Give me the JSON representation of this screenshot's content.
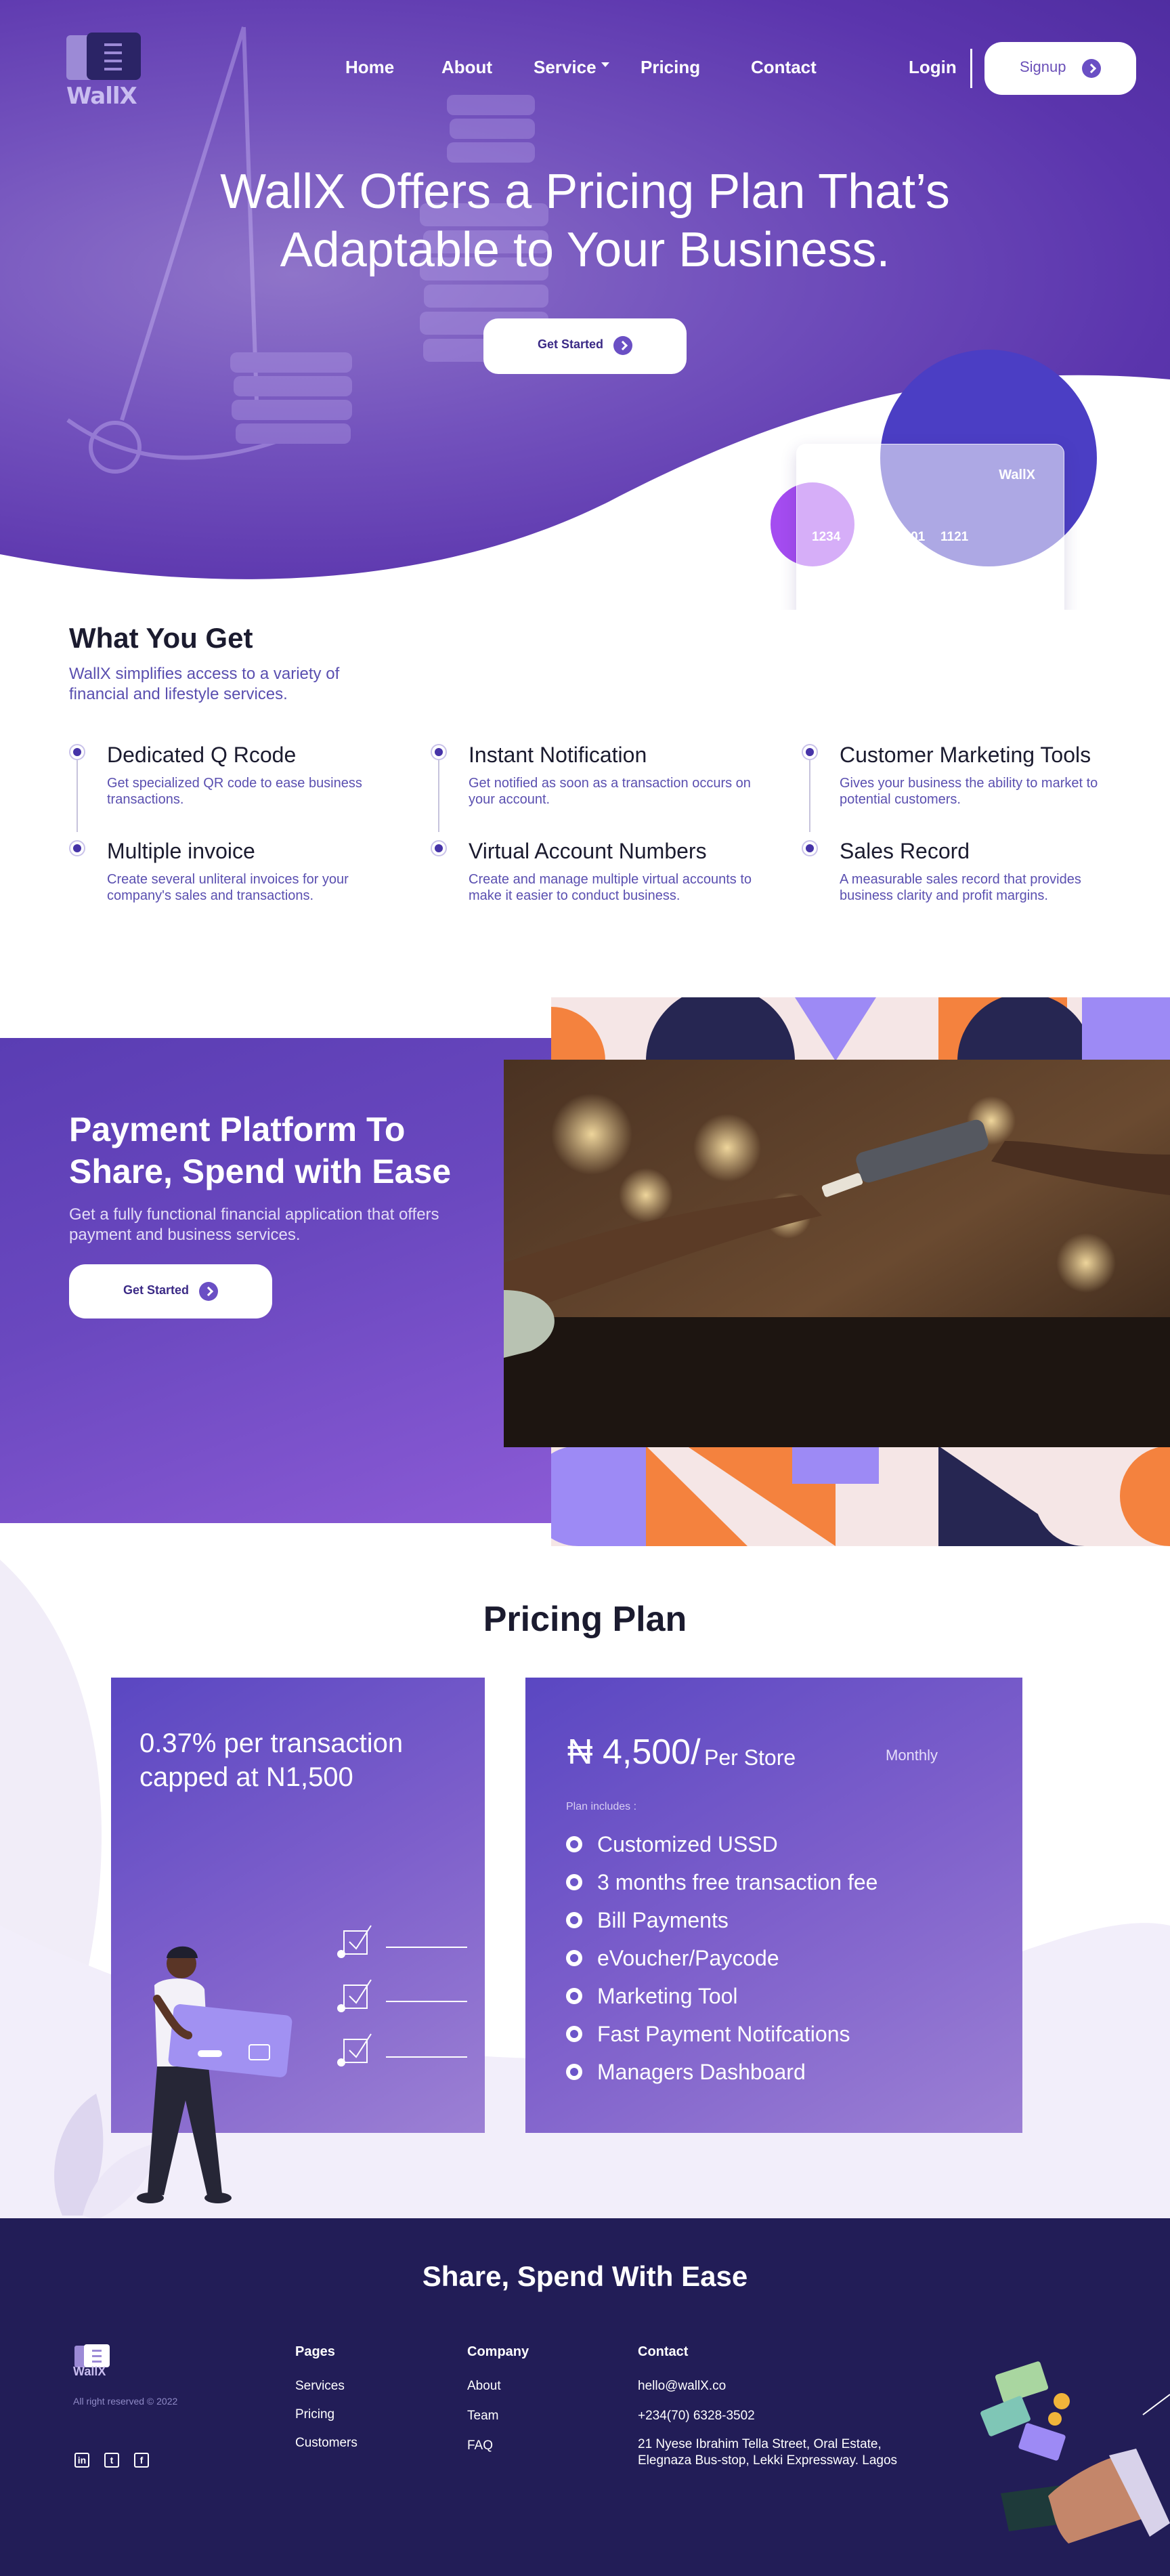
{
  "brand": {
    "name": "WallX"
  },
  "nav": {
    "home": "Home",
    "about": "About",
    "service": "Service",
    "pricing": "Pricing",
    "contact": "Contact",
    "login": "Login",
    "signup": "Signup"
  },
  "hero": {
    "title_line1": "WallX Offers a Pricing Plan That’s",
    "title_line2": "Adaptable to Your Business.",
    "cta": "Get Started",
    "card": {
      "brand": "WallX",
      "numbers": [
        "1234",
        "1101",
        "1121"
      ]
    }
  },
  "what_you_get": {
    "title": "What You Get",
    "subtitle": "WallX simplifies access to a variety of financial and lifestyle services.",
    "features": [
      {
        "title": "Dedicated Q Rcode",
        "desc": "Get specialized QR code to ease business transactions."
      },
      {
        "title": "Multiple invoice",
        "desc": "Create several unliteral invoices for your company's sales and transactions."
      },
      {
        "title": "Instant Notification",
        "desc": "Get notified as soon as a transaction occurs on your account."
      },
      {
        "title": "Virtual Account Numbers",
        "desc": "Create and manage multiple virtual accounts to make it easier to conduct business."
      },
      {
        "title": "Customer Marketing Tools",
        "desc": "Gives your business the ability to market to potential customers."
      },
      {
        "title": "Sales Record",
        "desc": "A measurable sales record that provides business clarity and  profit margins."
      }
    ]
  },
  "payment": {
    "title": "Payment Platform To Share, Spend with Ease",
    "subtitle": "Get a fully functional financial application that offers payment and business services.",
    "cta": "Get Started"
  },
  "pricing": {
    "title": "Pricing Plan",
    "plan1": {
      "headline": "0.37% per transaction capped at N1,500"
    },
    "plan2": {
      "price": "₦ 4,500/",
      "per": "Per Store",
      "period": "Monthly",
      "includes_label": "Plan includes :",
      "items": [
        "Customized USSD",
        "3 months free transaction fee",
        "Bill Payments",
        "eVoucher/Paycode",
        "Marketing Tool",
        "Fast Payment Notifcations",
        "Managers Dashboard"
      ]
    }
  },
  "footer": {
    "title": "Share, Spend With Ease",
    "copyright": "All right reserved © 2022",
    "pages": {
      "heading": "Pages",
      "links": [
        "Services",
        "Pricing",
        "Customers"
      ]
    },
    "company": {
      "heading": "Company",
      "links": [
        "About",
        "Team",
        "FAQ"
      ]
    },
    "contact": {
      "heading": "Contact",
      "email": "hello@wallX.co",
      "phone": "+234(70) 6328-3502",
      "address_line1": "21 Nyese Ibrahim Tella Street, Oral Estate,",
      "address_line2": "Elegnaza Bus-stop, Lekki Expressway. Lagos"
    },
    "social_icons": [
      "linkedin-icon",
      "twitter-icon",
      "facebook-icon"
    ]
  },
  "colors": {
    "primary": "#5b35ad",
    "accent": "#6a4fc4",
    "footer_bg": "#221d57",
    "orange": "#f4823e",
    "navy": "#262652"
  }
}
